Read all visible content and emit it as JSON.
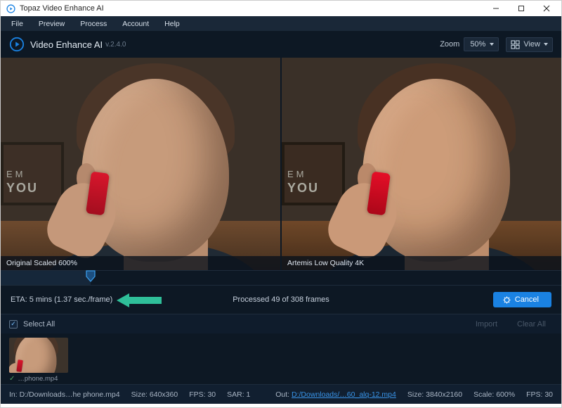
{
  "os_title": "Topaz Video Enhance AI",
  "menubar": {
    "file": "File",
    "preview": "Preview",
    "process": "Process",
    "account": "Account",
    "help": "Help"
  },
  "toolbar": {
    "app_title": "Video Enhance AI",
    "app_version": "v.2.4.0",
    "zoom_label": "Zoom",
    "zoom_value": "50%",
    "view_label": "View"
  },
  "preview": {
    "left_label": "Original Scaled 600%",
    "right_label": "Artemis Low Quality 4K",
    "poster_text_line1": "EM",
    "poster_text_line2": "YOU"
  },
  "progress": {
    "eta_text": "ETA:  5 mins  (1.37 sec./frame)",
    "processed_text": "Processed 49 of 308 frames",
    "cancel_label": "Cancel"
  },
  "queue": {
    "select_all_label": "Select All",
    "import_label": "Import",
    "clear_label": "Clear All",
    "thumb_name": "…phone.mp4"
  },
  "status": {
    "in_label": "In:",
    "in_path": "D:/Downloads…he phone.mp4",
    "in_size": "Size: 640x360",
    "in_fps": "FPS: 30",
    "in_sar": "SAR: 1",
    "out_label": "Out:",
    "out_path": "D:/Downloads/…60_alq-12.mp4",
    "out_size": "Size: 3840x2160",
    "out_scale": "Scale: 600%",
    "out_fps": "FPS: 30"
  }
}
